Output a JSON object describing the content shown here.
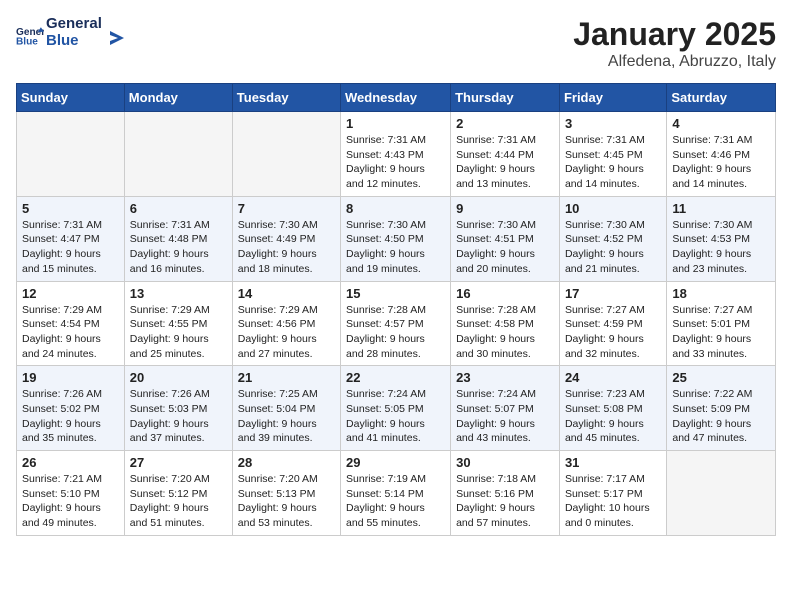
{
  "header": {
    "logo_general": "General",
    "logo_blue": "Blue",
    "title": "January 2025",
    "subtitle": "Alfedena, Abruzzo, Italy"
  },
  "weekdays": [
    "Sunday",
    "Monday",
    "Tuesday",
    "Wednesday",
    "Thursday",
    "Friday",
    "Saturday"
  ],
  "weeks": [
    {
      "days": [
        {
          "num": "",
          "info": ""
        },
        {
          "num": "",
          "info": ""
        },
        {
          "num": "",
          "info": ""
        },
        {
          "num": "1",
          "info": "Sunrise: 7:31 AM\nSunset: 4:43 PM\nDaylight: 9 hours\nand 12 minutes."
        },
        {
          "num": "2",
          "info": "Sunrise: 7:31 AM\nSunset: 4:44 PM\nDaylight: 9 hours\nand 13 minutes."
        },
        {
          "num": "3",
          "info": "Sunrise: 7:31 AM\nSunset: 4:45 PM\nDaylight: 9 hours\nand 14 minutes."
        },
        {
          "num": "4",
          "info": "Sunrise: 7:31 AM\nSunset: 4:46 PM\nDaylight: 9 hours\nand 14 minutes."
        }
      ]
    },
    {
      "days": [
        {
          "num": "5",
          "info": "Sunrise: 7:31 AM\nSunset: 4:47 PM\nDaylight: 9 hours\nand 15 minutes."
        },
        {
          "num": "6",
          "info": "Sunrise: 7:31 AM\nSunset: 4:48 PM\nDaylight: 9 hours\nand 16 minutes."
        },
        {
          "num": "7",
          "info": "Sunrise: 7:30 AM\nSunset: 4:49 PM\nDaylight: 9 hours\nand 18 minutes."
        },
        {
          "num": "8",
          "info": "Sunrise: 7:30 AM\nSunset: 4:50 PM\nDaylight: 9 hours\nand 19 minutes."
        },
        {
          "num": "9",
          "info": "Sunrise: 7:30 AM\nSunset: 4:51 PM\nDaylight: 9 hours\nand 20 minutes."
        },
        {
          "num": "10",
          "info": "Sunrise: 7:30 AM\nSunset: 4:52 PM\nDaylight: 9 hours\nand 21 minutes."
        },
        {
          "num": "11",
          "info": "Sunrise: 7:30 AM\nSunset: 4:53 PM\nDaylight: 9 hours\nand 23 minutes."
        }
      ]
    },
    {
      "days": [
        {
          "num": "12",
          "info": "Sunrise: 7:29 AM\nSunset: 4:54 PM\nDaylight: 9 hours\nand 24 minutes."
        },
        {
          "num": "13",
          "info": "Sunrise: 7:29 AM\nSunset: 4:55 PM\nDaylight: 9 hours\nand 25 minutes."
        },
        {
          "num": "14",
          "info": "Sunrise: 7:29 AM\nSunset: 4:56 PM\nDaylight: 9 hours\nand 27 minutes."
        },
        {
          "num": "15",
          "info": "Sunrise: 7:28 AM\nSunset: 4:57 PM\nDaylight: 9 hours\nand 28 minutes."
        },
        {
          "num": "16",
          "info": "Sunrise: 7:28 AM\nSunset: 4:58 PM\nDaylight: 9 hours\nand 30 minutes."
        },
        {
          "num": "17",
          "info": "Sunrise: 7:27 AM\nSunset: 4:59 PM\nDaylight: 9 hours\nand 32 minutes."
        },
        {
          "num": "18",
          "info": "Sunrise: 7:27 AM\nSunset: 5:01 PM\nDaylight: 9 hours\nand 33 minutes."
        }
      ]
    },
    {
      "days": [
        {
          "num": "19",
          "info": "Sunrise: 7:26 AM\nSunset: 5:02 PM\nDaylight: 9 hours\nand 35 minutes."
        },
        {
          "num": "20",
          "info": "Sunrise: 7:26 AM\nSunset: 5:03 PM\nDaylight: 9 hours\nand 37 minutes."
        },
        {
          "num": "21",
          "info": "Sunrise: 7:25 AM\nSunset: 5:04 PM\nDaylight: 9 hours\nand 39 minutes."
        },
        {
          "num": "22",
          "info": "Sunrise: 7:24 AM\nSunset: 5:05 PM\nDaylight: 9 hours\nand 41 minutes."
        },
        {
          "num": "23",
          "info": "Sunrise: 7:24 AM\nSunset: 5:07 PM\nDaylight: 9 hours\nand 43 minutes."
        },
        {
          "num": "24",
          "info": "Sunrise: 7:23 AM\nSunset: 5:08 PM\nDaylight: 9 hours\nand 45 minutes."
        },
        {
          "num": "25",
          "info": "Sunrise: 7:22 AM\nSunset: 5:09 PM\nDaylight: 9 hours\nand 47 minutes."
        }
      ]
    },
    {
      "days": [
        {
          "num": "26",
          "info": "Sunrise: 7:21 AM\nSunset: 5:10 PM\nDaylight: 9 hours\nand 49 minutes."
        },
        {
          "num": "27",
          "info": "Sunrise: 7:20 AM\nSunset: 5:12 PM\nDaylight: 9 hours\nand 51 minutes."
        },
        {
          "num": "28",
          "info": "Sunrise: 7:20 AM\nSunset: 5:13 PM\nDaylight: 9 hours\nand 53 minutes."
        },
        {
          "num": "29",
          "info": "Sunrise: 7:19 AM\nSunset: 5:14 PM\nDaylight: 9 hours\nand 55 minutes."
        },
        {
          "num": "30",
          "info": "Sunrise: 7:18 AM\nSunset: 5:16 PM\nDaylight: 9 hours\nand 57 minutes."
        },
        {
          "num": "31",
          "info": "Sunrise: 7:17 AM\nSunset: 5:17 PM\nDaylight: 10 hours\nand 0 minutes."
        },
        {
          "num": "",
          "info": ""
        }
      ]
    }
  ]
}
